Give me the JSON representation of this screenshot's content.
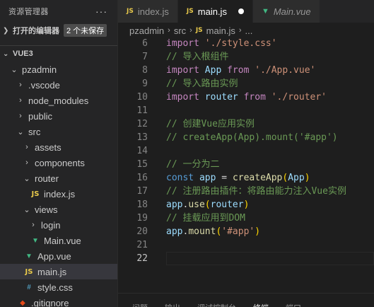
{
  "sidebar": {
    "title": "资源管理器",
    "more": "···",
    "open_editors_label": "打开的编辑器",
    "unsaved_badge": "2 个未保存",
    "project": "VUE3",
    "tree": [
      {
        "label": "pzadmin",
        "type": "folder",
        "expanded": true,
        "depth": 1
      },
      {
        "label": ".vscode",
        "type": "folder",
        "expanded": false,
        "depth": 2
      },
      {
        "label": "node_modules",
        "type": "folder",
        "expanded": false,
        "depth": 2
      },
      {
        "label": "public",
        "type": "folder",
        "expanded": false,
        "depth": 2
      },
      {
        "label": "src",
        "type": "folder",
        "expanded": true,
        "depth": 2
      },
      {
        "label": "assets",
        "type": "folder",
        "expanded": false,
        "depth": 3
      },
      {
        "label": "components",
        "type": "folder",
        "expanded": false,
        "depth": 3
      },
      {
        "label": "router",
        "type": "folder",
        "expanded": true,
        "depth": 3
      },
      {
        "label": "index.js",
        "type": "js",
        "depth": 4
      },
      {
        "label": "views",
        "type": "folder",
        "expanded": true,
        "depth": 3
      },
      {
        "label": "login",
        "type": "folder",
        "expanded": false,
        "depth": 4
      },
      {
        "label": "Main.vue",
        "type": "vue",
        "depth": 4
      },
      {
        "label": "App.vue",
        "type": "vue",
        "depth": 3
      },
      {
        "label": "main.js",
        "type": "js",
        "depth": 3,
        "active": true
      },
      {
        "label": "style.css",
        "type": "css",
        "depth": 3
      },
      {
        "label": ".gitignore",
        "type": "git",
        "depth": 2
      }
    ]
  },
  "tabs": [
    {
      "label": "index.js",
      "icon": "JS",
      "type": "js"
    },
    {
      "label": "main.js",
      "icon": "JS",
      "type": "js",
      "active": true,
      "dirty": true
    },
    {
      "label": "Main.vue",
      "icon": "V",
      "type": "vue",
      "preview": true
    }
  ],
  "breadcrumb": {
    "parts": [
      "pzadmin",
      "src",
      "main.js",
      "..."
    ],
    "js_icon": "JS"
  },
  "editor": {
    "current_line": 22,
    "lines": [
      {
        "n": 6,
        "tokens": [
          [
            "kw",
            "import"
          ],
          [
            "pl",
            " "
          ],
          [
            "str",
            "'./style.css'"
          ]
        ]
      },
      {
        "n": 7,
        "tokens": [
          [
            "cm",
            "// 导入根组件"
          ]
        ]
      },
      {
        "n": 8,
        "tokens": [
          [
            "kw",
            "import"
          ],
          [
            "pl",
            " "
          ],
          [
            "var",
            "App"
          ],
          [
            "pl",
            " "
          ],
          [
            "kw",
            "from"
          ],
          [
            "pl",
            " "
          ],
          [
            "str",
            "'./App.vue'"
          ]
        ]
      },
      {
        "n": 9,
        "tokens": [
          [
            "cm",
            "// 导入路由实例"
          ]
        ]
      },
      {
        "n": 10,
        "tokens": [
          [
            "kw",
            "import"
          ],
          [
            "pl",
            " "
          ],
          [
            "var",
            "router"
          ],
          [
            "pl",
            " "
          ],
          [
            "kw",
            "from"
          ],
          [
            "pl",
            " "
          ],
          [
            "str",
            "'./router'"
          ]
        ]
      },
      {
        "n": 11,
        "tokens": []
      },
      {
        "n": 12,
        "tokens": [
          [
            "cm",
            "// 创建Vue应用实例"
          ]
        ]
      },
      {
        "n": 13,
        "tokens": [
          [
            "cm",
            "// createApp(App).mount('#app')"
          ]
        ]
      },
      {
        "n": 14,
        "tokens": []
      },
      {
        "n": 15,
        "tokens": [
          [
            "cm",
            "// 一分为二"
          ]
        ]
      },
      {
        "n": 16,
        "tokens": [
          [
            "kwb",
            "const"
          ],
          [
            "pl",
            " "
          ],
          [
            "var",
            "app"
          ],
          [
            "pl",
            " = "
          ],
          [
            "fn",
            "createApp"
          ],
          [
            "br1",
            "("
          ],
          [
            "var",
            "App"
          ],
          [
            "br1",
            ")"
          ]
        ]
      },
      {
        "n": 17,
        "tokens": [
          [
            "cm",
            "// 注册路由插件：将路由能力注入Vue实例"
          ]
        ]
      },
      {
        "n": 18,
        "tokens": [
          [
            "var",
            "app"
          ],
          [
            "pl",
            "."
          ],
          [
            "fn",
            "use"
          ],
          [
            "br1",
            "("
          ],
          [
            "var",
            "router"
          ],
          [
            "br1",
            ")"
          ]
        ]
      },
      {
        "n": 19,
        "tokens": [
          [
            "cm",
            "// 挂载应用到DOM"
          ]
        ]
      },
      {
        "n": 20,
        "tokens": [
          [
            "var",
            "app"
          ],
          [
            "pl",
            "."
          ],
          [
            "fn",
            "mount"
          ],
          [
            "br1",
            "("
          ],
          [
            "str",
            "'#app'"
          ],
          [
            "br1",
            ")"
          ]
        ]
      },
      {
        "n": 21,
        "tokens": []
      },
      {
        "n": 22,
        "tokens": []
      }
    ]
  },
  "panel": {
    "tabs": [
      "问题",
      "输出",
      "调试控制台",
      "终端",
      "端口"
    ],
    "active": 3
  },
  "colors": {
    "keyword": "#c586c0",
    "string": "#ce9178",
    "comment": "#6a9955",
    "variable": "#9cdcfe",
    "function": "#dcdcaa",
    "js_icon": "#e8c94b",
    "vue_icon": "#41b883",
    "css_icon": "#519aba",
    "git_icon": "#e64a19"
  }
}
